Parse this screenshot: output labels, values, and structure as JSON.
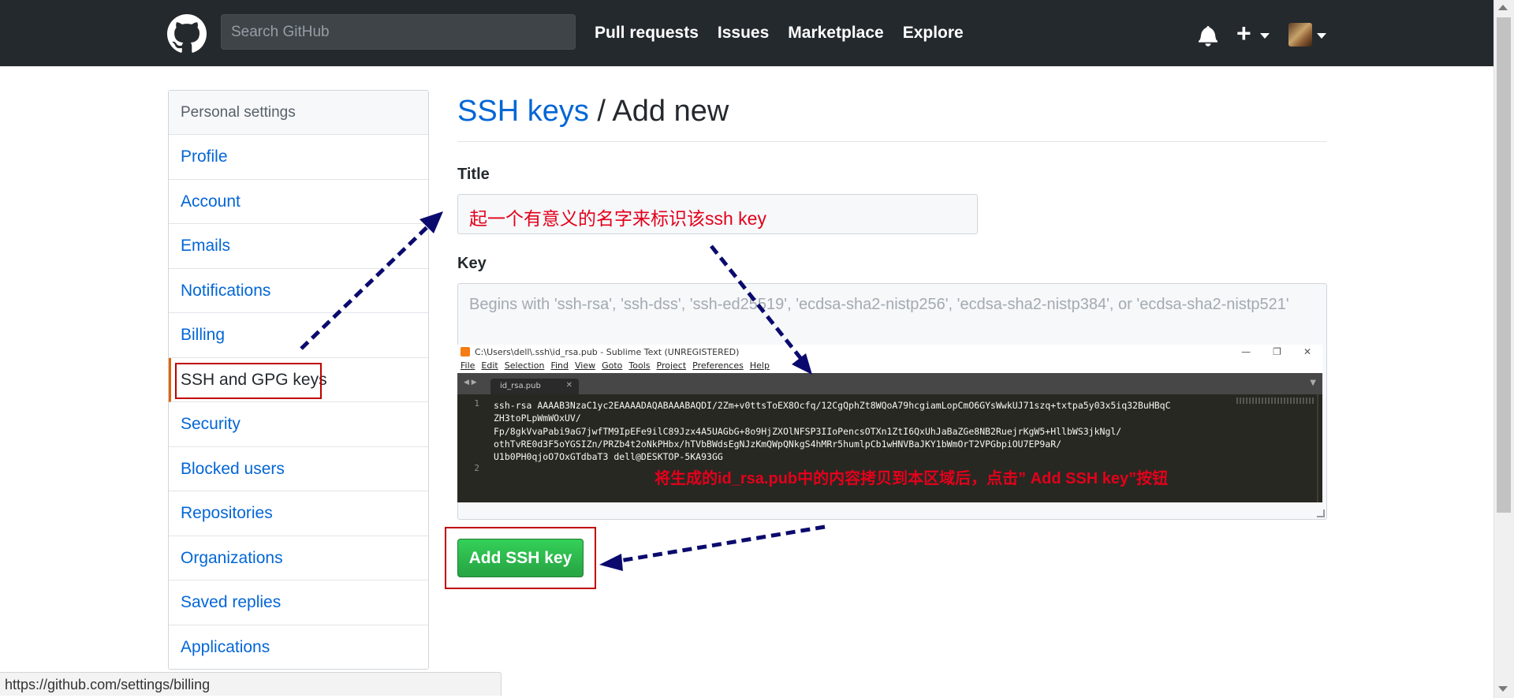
{
  "header": {
    "search_placeholder": "Search GitHub",
    "nav": [
      "Pull requests",
      "Issues",
      "Marketplace",
      "Explore"
    ],
    "plus": "+"
  },
  "sidebar": {
    "heading": "Personal settings",
    "items": [
      "Profile",
      "Account",
      "Emails",
      "Notifications",
      "Billing",
      "SSH and GPG keys",
      "Security",
      "Blocked users",
      "Repositories",
      "Organizations",
      "Saved replies",
      "Applications"
    ],
    "selected": "SSH and GPG keys"
  },
  "main": {
    "title_link": "SSH keys",
    "title_rest": " / Add new",
    "title_label": "Title",
    "title_value": "起一个有意义的名字来标识该ssh key",
    "key_label": "Key",
    "key_placeholder": "Begins with 'ssh-rsa', 'ssh-dss', 'ssh-ed25519', 'ecdsa-sha2-nistp256', 'ecdsa-sha2-nistp384', or 'ecdsa-sha2-nistp521'",
    "submit_label": "Add SSH key"
  },
  "sublime": {
    "window_title": "C:\\Users\\dell\\.ssh\\id_rsa.pub - Sublime Text (UNREGISTERED)",
    "window_buttons": [
      "—",
      "❐",
      "✕"
    ],
    "menu": [
      "File",
      "Edit",
      "Selection",
      "Find",
      "View",
      "Goto",
      "Tools",
      "Project",
      "Preferences",
      "Help"
    ],
    "tab_name": "id_rsa.pub",
    "line_numbers": [
      "1",
      "2"
    ],
    "code_lines": [
      "ssh-rsa AAAAB3NzaC1yc2EAAAADAQABAAABAQDI/2Zm+v0ttsToEX8Ocfq/12CgQphZt8WQoA79hcgiamLopCmO6GYsWwkUJ71szq+txtpa5y03x5iq32BuHBqC",
      "ZH3toPLpWmWOxUV/",
      "Fp/8gkVvaPabi9aG7jwfTM9IpEFe9ilC89Jzx4A5UAGbG+8o9HjZXOlNFSP3IIoPencsOTXn1ZtI6QxUhJaBaZGe8NB2RuejrKgW5+HllbWS3jkNgl/",
      "othTvRE0d3F5oYGSIZn/PRZb4t2oNkPHbx/hTVbBWdsEgNJzKmQWpQNkgS4hMRr5humlpCb1wHNVBaJKY1bWmOrT2VPGbpiOU7EP9aR/",
      "U1b0PH0qjoO7OxGTdbaT3 dell@DESKTOP-5KA93GG"
    ],
    "annotation": "将生成的id_rsa.pub中的内容拷贝到本区域后，点击” Add SSH key”按钮"
  },
  "statusbar": {
    "url": "https://github.com/settings/billing"
  },
  "colors": {
    "header_bg": "#24292e",
    "link": "#0366d6",
    "annotation_red": "#e3001b",
    "arrow_navy": "#0a0a6e",
    "button_green": "#28a745"
  }
}
